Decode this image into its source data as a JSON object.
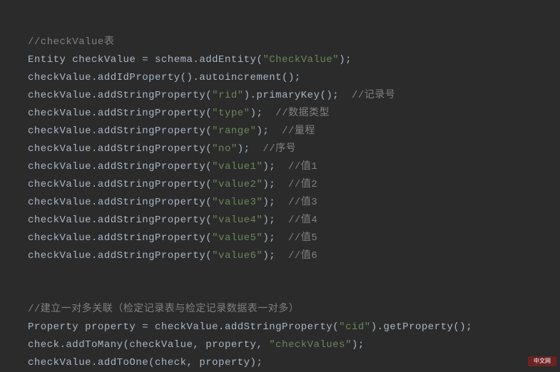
{
  "lines": [
    {
      "type": "comment",
      "text": "//checkValue表"
    },
    {
      "type": "code",
      "segments": [
        {
          "c": "keyword",
          "t": "Entity checkValue = schema.addEntity("
        },
        {
          "c": "string",
          "t": "\"CheckValue\""
        },
        {
          "c": "punct",
          "t": ");"
        }
      ]
    },
    {
      "type": "code",
      "segments": [
        {
          "c": "keyword",
          "t": "checkValue.addIdProperty().autoincrement();"
        }
      ]
    },
    {
      "type": "code",
      "segments": [
        {
          "c": "keyword",
          "t": "checkValue.addStringProperty("
        },
        {
          "c": "string",
          "t": "\"rid\""
        },
        {
          "c": "punct",
          "t": ").primaryKey();  "
        },
        {
          "c": "comment",
          "t": "//记录号"
        }
      ]
    },
    {
      "type": "code",
      "segments": [
        {
          "c": "keyword",
          "t": "checkValue.addStringProperty("
        },
        {
          "c": "string",
          "t": "\"type\""
        },
        {
          "c": "punct",
          "t": ");  "
        },
        {
          "c": "comment",
          "t": "//数据类型"
        }
      ]
    },
    {
      "type": "code",
      "segments": [
        {
          "c": "keyword",
          "t": "checkValue.addStringProperty("
        },
        {
          "c": "string",
          "t": "\"range\""
        },
        {
          "c": "punct",
          "t": ");  "
        },
        {
          "c": "comment",
          "t": "//量程"
        }
      ]
    },
    {
      "type": "code",
      "segments": [
        {
          "c": "keyword",
          "t": "checkValue.addStringProperty("
        },
        {
          "c": "string",
          "t": "\"no\""
        },
        {
          "c": "punct",
          "t": ");  "
        },
        {
          "c": "comment",
          "t": "//序号"
        }
      ]
    },
    {
      "type": "code",
      "segments": [
        {
          "c": "keyword",
          "t": "checkValue.addStringProperty("
        },
        {
          "c": "string",
          "t": "\"value1\""
        },
        {
          "c": "punct",
          "t": ");  "
        },
        {
          "c": "comment",
          "t": "//值1"
        }
      ]
    },
    {
      "type": "code",
      "segments": [
        {
          "c": "keyword",
          "t": "checkValue.addStringProperty("
        },
        {
          "c": "string",
          "t": "\"value2\""
        },
        {
          "c": "punct",
          "t": ");  "
        },
        {
          "c": "comment",
          "t": "//值2"
        }
      ]
    },
    {
      "type": "code",
      "segments": [
        {
          "c": "keyword",
          "t": "checkValue.addStringProperty("
        },
        {
          "c": "string",
          "t": "\"value3\""
        },
        {
          "c": "punct",
          "t": ");  "
        },
        {
          "c": "comment",
          "t": "//值3"
        }
      ]
    },
    {
      "type": "code",
      "segments": [
        {
          "c": "keyword",
          "t": "checkValue.addStringProperty("
        },
        {
          "c": "string",
          "t": "\"value4\""
        },
        {
          "c": "punct",
          "t": ");  "
        },
        {
          "c": "comment",
          "t": "//值4"
        }
      ]
    },
    {
      "type": "code",
      "segments": [
        {
          "c": "keyword",
          "t": "checkValue.addStringProperty("
        },
        {
          "c": "string",
          "t": "\"value5\""
        },
        {
          "c": "punct",
          "t": ");  "
        },
        {
          "c": "comment",
          "t": "//值5"
        }
      ]
    },
    {
      "type": "code",
      "segments": [
        {
          "c": "keyword",
          "t": "checkValue.addStringProperty("
        },
        {
          "c": "string",
          "t": "\"value6\""
        },
        {
          "c": "punct",
          "t": ");  "
        },
        {
          "c": "comment",
          "t": "//值6"
        }
      ]
    },
    {
      "type": "blank"
    },
    {
      "type": "comment",
      "text": "//建立一对多关联（检定记录表与检定记录数据表一对多）"
    },
    {
      "type": "code",
      "segments": [
        {
          "c": "keyword",
          "t": "Property property = checkValue.addStringProperty("
        },
        {
          "c": "string",
          "t": "\"cid\""
        },
        {
          "c": "punct",
          "t": ").getProperty();"
        }
      ]
    },
    {
      "type": "code",
      "segments": [
        {
          "c": "keyword",
          "t": "check.addToMany(checkValue, property, "
        },
        {
          "c": "string",
          "t": "\"checkValues\""
        },
        {
          "c": "punct",
          "t": ");"
        }
      ]
    },
    {
      "type": "code",
      "segments": [
        {
          "c": "keyword",
          "t": "checkValue.addToOne(check, property);"
        }
      ]
    }
  ],
  "watermark": "中文网"
}
